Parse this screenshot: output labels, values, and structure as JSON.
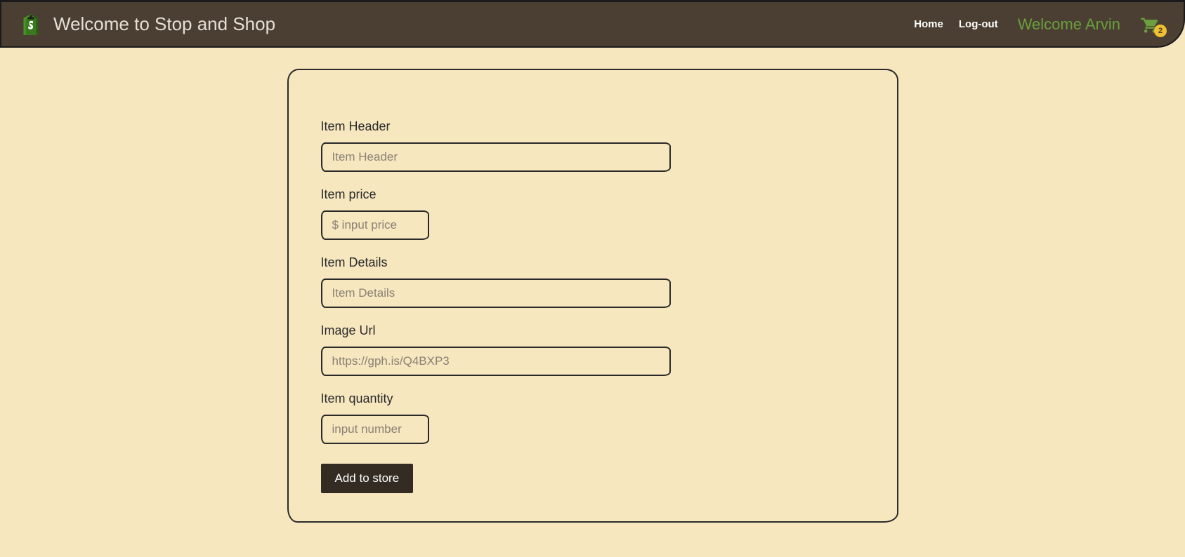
{
  "navbar": {
    "brand_title": "Welcome to Stop and Shop",
    "home_label": "Home",
    "logout_label": "Log-out",
    "welcome_user": "Welcome Arvin",
    "cart_count": "2"
  },
  "form": {
    "item_header": {
      "label": "Item Header",
      "placeholder": "Item Header",
      "value": ""
    },
    "item_price": {
      "label": "Item price",
      "placeholder": "$ input price",
      "value": ""
    },
    "item_details": {
      "label": "Item Details",
      "placeholder": "Item Details",
      "value": ""
    },
    "image_url": {
      "label": "Image Url",
      "placeholder": "https://gph.is/Q4BXP3",
      "value": ""
    },
    "item_quantity": {
      "label": "Item quantity",
      "placeholder": "input number",
      "value": ""
    },
    "submit_label": "Add to store"
  }
}
